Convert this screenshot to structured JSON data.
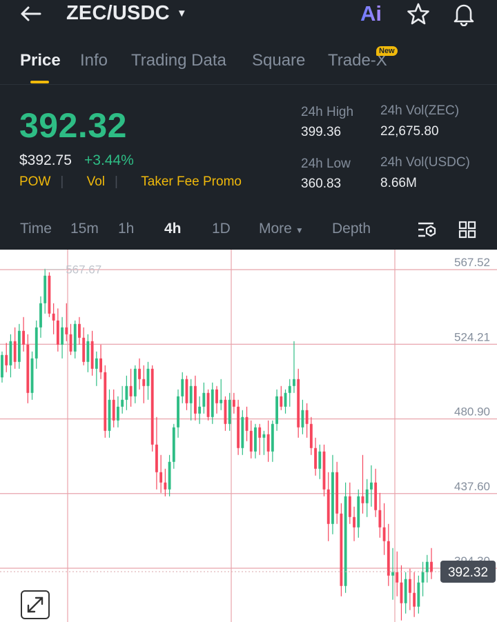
{
  "header": {
    "pair": "ZEC/USDC",
    "ai_label": "Ai",
    "icons": [
      "back-arrow-icon",
      "chevron-down-icon",
      "star-icon",
      "bell-icon"
    ]
  },
  "tabs": [
    {
      "label": "Price",
      "active": true
    },
    {
      "label": "Info"
    },
    {
      "label": "Trading Data"
    },
    {
      "label": "Square"
    },
    {
      "label": "Trade-X",
      "badge": "New"
    }
  ],
  "ticker": {
    "last_price": "392.32",
    "usd_price": "$392.75",
    "change_pct": "+3.44%",
    "tags": [
      "POW",
      "Vol",
      "Taker Fee Promo"
    ],
    "high_label": "24h High",
    "high_value": "399.36",
    "low_label": "24h Low",
    "low_value": "360.83",
    "vol_base_label": "24h Vol(ZEC)",
    "vol_base_value": "22,675.80",
    "vol_quote_label": "24h Vol(USDC)",
    "vol_quote_value": "8.66M"
  },
  "intervals": {
    "items": [
      "Time",
      "15m",
      "1h",
      "4h",
      "1D"
    ],
    "active": "4h",
    "more_label": "More",
    "depth_label": "Depth"
  },
  "chart": {
    "y_ticks": [
      "567.52",
      "524.21",
      "480.90",
      "437.60",
      "394.30"
    ],
    "current_price_tag": "392.32",
    "high_marker": "567.67",
    "colors": {
      "up": "#2ebd85",
      "down": "#f6465d",
      "grid": "#e8a3ab"
    }
  },
  "chart_data": {
    "type": "candlestick",
    "y_ticks": [
      567.52,
      524.21,
      480.9,
      437.6,
      394.3
    ],
    "ylim": [
      360,
      590
    ],
    "high_marker": 567.67,
    "last": 392.32,
    "candles": [
      [
        505,
        520,
        502,
        518
      ],
      [
        518,
        525,
        508,
        512
      ],
      [
        512,
        530,
        505,
        526
      ],
      [
        526,
        534,
        510,
        514
      ],
      [
        514,
        536,
        510,
        532
      ],
      [
        532,
        540,
        520,
        524
      ],
      [
        524,
        530,
        490,
        496
      ],
      [
        496,
        520,
        492,
        516
      ],
      [
        516,
        538,
        510,
        534
      ],
      [
        534,
        552,
        528,
        548
      ],
      [
        548,
        568,
        542,
        564
      ],
      [
        564,
        566,
        540,
        542
      ],
      [
        542,
        548,
        530,
        538
      ],
      [
        538,
        545,
        520,
        524
      ],
      [
        524,
        540,
        516,
        534
      ],
      [
        534,
        548,
        526,
        530
      ],
      [
        530,
        536,
        518,
        520
      ],
      [
        520,
        538,
        516,
        536
      ],
      [
        536,
        540,
        524,
        528
      ],
      [
        528,
        534,
        512,
        514
      ],
      [
        514,
        530,
        508,
        526
      ],
      [
        526,
        532,
        506,
        510
      ],
      [
        510,
        520,
        500,
        516
      ],
      [
        516,
        524,
        504,
        508
      ],
      [
        508,
        512,
        470,
        474
      ],
      [
        474,
        498,
        470,
        492
      ],
      [
        492,
        498,
        476,
        480
      ],
      [
        480,
        494,
        476,
        488
      ],
      [
        488,
        500,
        484,
        492
      ],
      [
        492,
        506,
        486,
        500
      ],
      [
        500,
        510,
        488,
        494
      ],
      [
        494,
        512,
        490,
        510
      ],
      [
        510,
        516,
        498,
        504
      ],
      [
        504,
        512,
        490,
        500
      ],
      [
        500,
        514,
        492,
        510
      ],
      [
        510,
        512,
        462,
        466
      ],
      [
        466,
        482,
        440,
        450
      ],
      [
        450,
        460,
        438,
        444
      ],
      [
        444,
        452,
        436,
        440
      ],
      [
        440,
        460,
        436,
        456
      ],
      [
        456,
        478,
        452,
        476
      ],
      [
        476,
        498,
        470,
        494
      ],
      [
        494,
        508,
        490,
        504
      ],
      [
        504,
        506,
        486,
        490
      ],
      [
        490,
        504,
        480,
        500
      ],
      [
        500,
        506,
        480,
        484
      ],
      [
        484,
        494,
        478,
        488
      ],
      [
        488,
        502,
        484,
        496
      ],
      [
        496,
        498,
        480,
        482
      ],
      [
        482,
        502,
        478,
        498
      ],
      [
        498,
        500,
        484,
        490
      ],
      [
        490,
        504,
        486,
        492
      ],
      [
        492,
        494,
        474,
        478
      ],
      [
        478,
        496,
        474,
        492
      ],
      [
        492,
        496,
        484,
        488
      ],
      [
        488,
        492,
        460,
        464
      ],
      [
        464,
        486,
        460,
        482
      ],
      [
        482,
        488,
        468,
        474
      ],
      [
        474,
        480,
        458,
        462
      ],
      [
        462,
        478,
        458,
        476
      ],
      [
        476,
        478,
        460,
        470
      ],
      [
        470,
        474,
        460,
        472
      ],
      [
        472,
        480,
        456,
        462
      ],
      [
        462,
        480,
        456,
        478
      ],
      [
        478,
        498,
        474,
        494
      ],
      [
        494,
        500,
        486,
        488
      ],
      [
        488,
        498,
        484,
        496
      ],
      [
        496,
        504,
        488,
        500
      ],
      [
        500,
        526,
        496,
        504
      ],
      [
        504,
        510,
        470,
        476
      ],
      [
        476,
        492,
        472,
        486
      ],
      [
        486,
        490,
        470,
        478
      ],
      [
        478,
        482,
        460,
        464
      ],
      [
        464,
        470,
        448,
        452
      ],
      [
        452,
        466,
        446,
        462
      ],
      [
        462,
        466,
        436,
        440
      ],
      [
        440,
        450,
        410,
        420
      ],
      [
        420,
        460,
        414,
        450
      ],
      [
        450,
        456,
        420,
        426
      ],
      [
        426,
        432,
        378,
        384
      ],
      [
        384,
        444,
        380,
        436
      ],
      [
        436,
        444,
        420,
        424
      ],
      [
        424,
        430,
        410,
        418
      ],
      [
        418,
        440,
        412,
        436
      ],
      [
        436,
        460,
        426,
        432
      ],
      [
        432,
        446,
        424,
        440
      ],
      [
        440,
        454,
        430,
        444
      ],
      [
        444,
        452,
        424,
        428
      ],
      [
        428,
        438,
        412,
        418
      ],
      [
        418,
        432,
        402,
        410
      ],
      [
        410,
        420,
        384,
        390
      ],
      [
        390,
        406,
        376,
        392
      ],
      [
        392,
        404,
        378,
        386
      ],
      [
        386,
        396,
        364,
        374
      ],
      [
        374,
        392,
        368,
        388
      ],
      [
        388,
        394,
        370,
        380
      ],
      [
        380,
        392,
        366,
        372
      ],
      [
        372,
        390,
        368,
        386
      ],
      [
        386,
        398,
        378,
        392
      ],
      [
        392,
        402,
        386,
        398
      ],
      [
        398,
        406,
        388,
        392
      ]
    ]
  }
}
